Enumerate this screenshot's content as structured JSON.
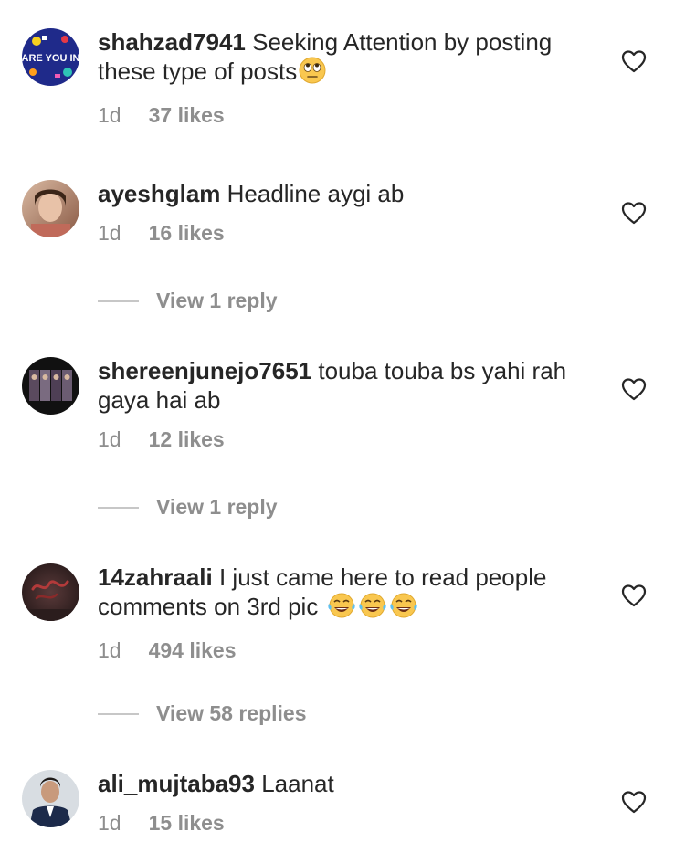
{
  "comments": [
    {
      "username": "shahzad7941",
      "text": "Seeking Attention  by posting these type of posts",
      "time": "1d",
      "likes": "37 likes",
      "emoji": [
        "rolling-eyes"
      ],
      "avatar_text": "ARE YOU IN"
    },
    {
      "username": "ayeshglam",
      "text": "Headline aygi ab",
      "time": "1d",
      "likes": "16 likes",
      "view_replies": "View 1 reply"
    },
    {
      "username": "shereenjunejo7651",
      "text": "touba touba bs yahi rah gaya hai ab",
      "time": "1d",
      "likes": "12 likes",
      "view_replies": "View 1 reply"
    },
    {
      "username": "14zahraali",
      "text": "I just came here to read people comments on 3rd pic",
      "time": "1d",
      "likes": "494 likes",
      "emoji": [
        "face-with-tears-of-joy",
        "face-with-tears-of-joy",
        "face-with-tears-of-joy"
      ],
      "view_replies": "View 58 replies"
    },
    {
      "username": "ali_mujtaba93",
      "text": "Laanat",
      "time": "1d",
      "likes": "15 likes"
    }
  ],
  "icons": {
    "like": "heart-outline-icon"
  },
  "colors": {
    "text": "#262626",
    "secondary": "#8e8e8e",
    "divider": "#c7c7c7"
  }
}
